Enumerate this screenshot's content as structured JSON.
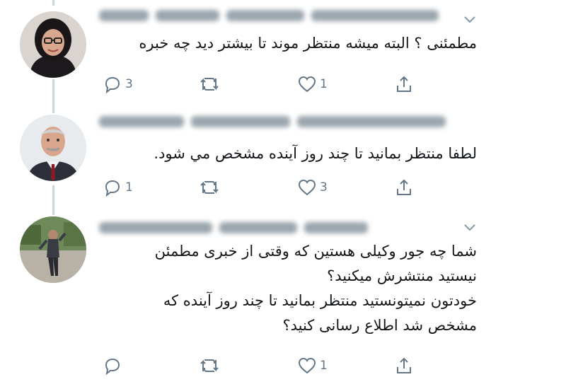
{
  "tweets": [
    {
      "text_lines": [
        "مطمئنی ؟ البته میشه منتظر موند تا بیشتر دید چه خبره"
      ],
      "reply_count": "3",
      "retweet_count": "",
      "like_count": "1"
    },
    {
      "text_lines": [
        "لطفا منتظر بمانید تا چند روز آینده مشخص مي شود."
      ],
      "reply_count": "1",
      "retweet_count": "",
      "like_count": "3"
    },
    {
      "text_lines": [
        "شما چه جور وکیلی هستین که وقتی از خبری مطمئن",
        "نیستید منتشرش میکنید؟",
        "خودتون نمیتونستید منتظر بمانید تا چند روز آینده که",
        "مشخص شد اطلاع رسانی کنید؟"
      ],
      "reply_count": "",
      "retweet_count": "",
      "like_count": "1"
    }
  ],
  "icons": {
    "reply": "reply-icon",
    "retweet": "retweet-icon",
    "like": "heart-icon",
    "share": "share-icon",
    "caret": "chevron-down-icon"
  },
  "colors": {
    "text": "#14171a",
    "icon": "#657786",
    "thread_line": "#ccd6dd"
  }
}
